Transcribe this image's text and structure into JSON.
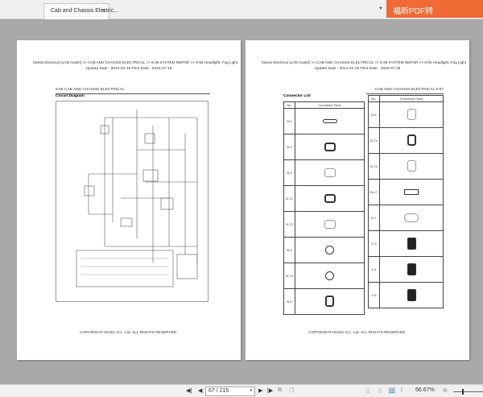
{
  "tab": {
    "title": "Cab and Chassis Electric...",
    "close": "x"
  },
  "brand": "福昕PDF转",
  "pages": {
    "left": {
      "breadcrumb": "hassis Electrical (LHD model) >> CAB AND CHASSIS ELECTRICAL >> 8-39 SYSTEM REPAIR >> 8-84 Headlight, Fog Light",
      "dates": "Update Date : 2014-02-16   Print Date : 2022-07-18",
      "section": "8-66   CAB AND CHASSIS ELECTRICAL",
      "subtitle": "Circuit Diagram",
      "copyright": "COPYRIGHT ISUZU Co., Ltd. ALL RIGHTS RESERVED."
    },
    "right": {
      "breadcrumb": "hassis Electrical (LHD model) >> CAB AND CHASSIS ELECTRICAL >> 8-39 SYSTEM REPAIR >> 8-84 Headlight, Fog Light",
      "dates": "Update Date : 2014-02-16   Print Date : 2022-07-18",
      "section": "CAB AND CHASSIS ELECTRICAL   8-67",
      "subtitle": "Connector List",
      "col_no": "No.",
      "col_face": "Connector Face",
      "left_rows": [
        "B-1",
        "B-3",
        "B-3",
        "B-72",
        "B-72",
        "B-4",
        "B-73",
        "B-5"
      ],
      "right_rows": [
        "B-5",
        "B-74",
        "B-74",
        "B-17",
        "B-7",
        "X-3",
        "X-4",
        "X-6"
      ],
      "copyright": "COPYRIGHT ISUZU Co., Ltd. ALL RIGHTS RESERVED."
    }
  },
  "toolbar": {
    "page_value": "67 / 215",
    "zoom": "66.67%"
  }
}
